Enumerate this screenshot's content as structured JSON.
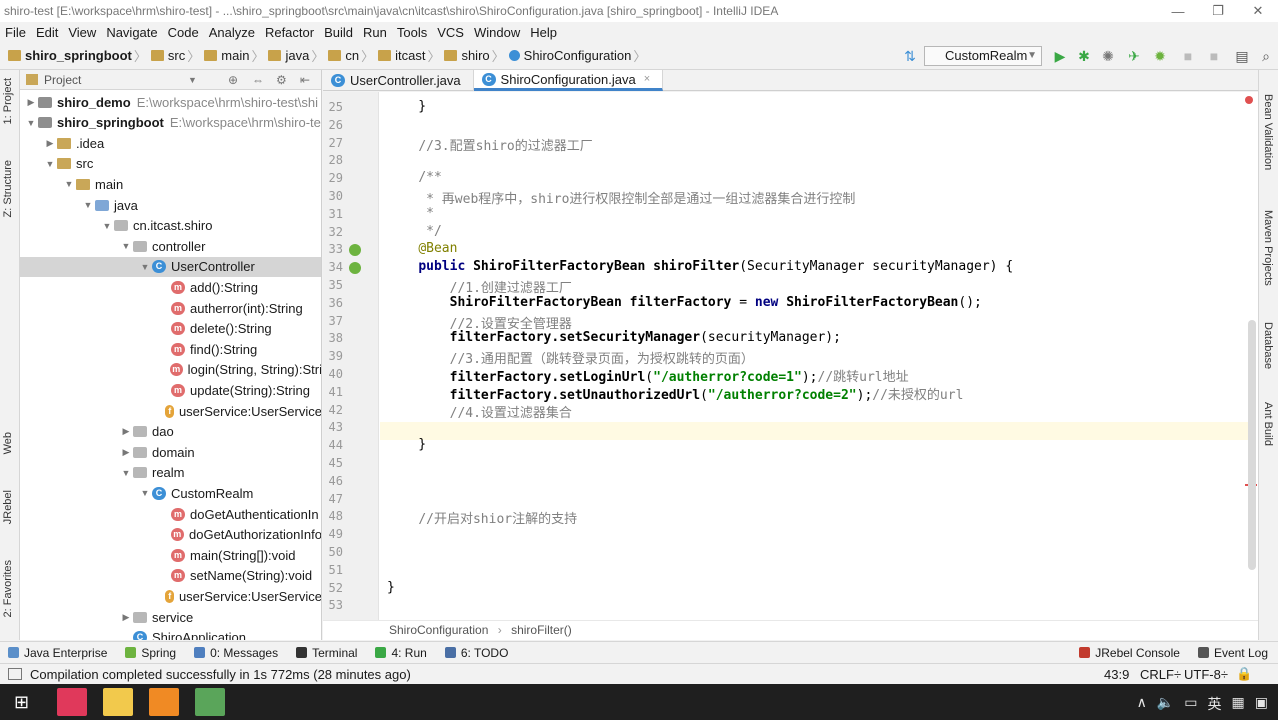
{
  "window": {
    "title": "shiro-test [E:\\workspace\\hrm\\shiro-test] - ...\\shiro_springboot\\src\\main\\java\\cn\\itcast\\shiro\\ShiroConfiguration.java [shiro_springboot] - IntelliJ IDEA",
    "minimize": "—",
    "maximize": "❐",
    "close": "✕"
  },
  "menu": [
    "File",
    "Edit",
    "View",
    "Navigate",
    "Code",
    "Analyze",
    "Refactor",
    "Build",
    "Run",
    "Tools",
    "VCS",
    "Window",
    "Help"
  ],
  "breadcrumb": [
    "shiro_springboot",
    "src",
    "main",
    "java",
    "cn",
    "itcast",
    "shiro",
    "ShiroConfiguration"
  ],
  "run_config": "CustomRealm",
  "left_strip": {
    "project": "1: Project",
    "structure": "Z: Structure",
    "web": "Web",
    "jrebel": "JRebel",
    "favorites": "2: Favorites"
  },
  "right_strip": {
    "bean": "Bean Validation",
    "maven": "Maven Projects",
    "db": "Database",
    "ant": "Ant Build"
  },
  "project_panel": {
    "header": "Project",
    "rows": [
      {
        "label": "shiro_demo",
        "path": "E:\\workspace\\hrm\\shiro-test\\shi",
        "icon": "proj",
        "arrow": "▶",
        "bold": true
      },
      {
        "label": "shiro_springboot",
        "path": "E:\\workspace\\hrm\\shiro-te",
        "icon": "proj",
        "arrow": "▼",
        "bold": true
      },
      {
        "label": ".idea",
        "path": "",
        "icon": "folder",
        "arrow": "▶",
        "bold": false
      },
      {
        "label": "src",
        "path": "",
        "icon": "folder",
        "arrow": "▼",
        "bold": false
      },
      {
        "label": "main",
        "path": "",
        "icon": "folder",
        "arrow": "▼",
        "bold": false
      },
      {
        "label": "java",
        "path": "",
        "icon": "src",
        "arrow": "▼",
        "bold": false
      },
      {
        "label": "cn.itcast.shiro",
        "path": "",
        "icon": "pkg",
        "arrow": "▼",
        "bold": false
      },
      {
        "label": "controller",
        "path": "",
        "icon": "pkg",
        "arrow": "▼",
        "bold": false
      },
      {
        "label": "UserController",
        "path": "",
        "icon": "cls",
        "arrow": "▼",
        "bold": false
      },
      {
        "label": "add():String",
        "path": "",
        "icon": "m",
        "arrow": "",
        "bold": false
      },
      {
        "label": "autherror(int):String",
        "path": "",
        "icon": "m",
        "arrow": "",
        "bold": false
      },
      {
        "label": "delete():String",
        "path": "",
        "icon": "m",
        "arrow": "",
        "bold": false
      },
      {
        "label": "find():String",
        "path": "",
        "icon": "m",
        "arrow": "",
        "bold": false
      },
      {
        "label": "login(String, String):Stri",
        "path": "",
        "icon": "m",
        "arrow": "",
        "bold": false
      },
      {
        "label": "update(String):String",
        "path": "",
        "icon": "m",
        "arrow": "",
        "bold": false
      },
      {
        "label": "userService:UserService",
        "path": "",
        "icon": "f",
        "arrow": "",
        "bold": false
      },
      {
        "label": "dao",
        "path": "",
        "icon": "pkg",
        "arrow": "▶",
        "bold": false
      },
      {
        "label": "domain",
        "path": "",
        "icon": "pkg",
        "arrow": "▶",
        "bold": false
      },
      {
        "label": "realm",
        "path": "",
        "icon": "pkg",
        "arrow": "▼",
        "bold": false
      },
      {
        "label": "CustomRealm",
        "path": "",
        "icon": "cls",
        "arrow": "▼",
        "bold": false
      },
      {
        "label": "doGetAuthenticationIn",
        "path": "",
        "icon": "m",
        "arrow": "",
        "bold": false
      },
      {
        "label": "doGetAuthorizationInfo",
        "path": "",
        "icon": "m",
        "arrow": "",
        "bold": false
      },
      {
        "label": "main(String[]):void",
        "path": "",
        "icon": "m",
        "arrow": "",
        "bold": false
      },
      {
        "label": "setName(String):void",
        "path": "",
        "icon": "m",
        "arrow": "",
        "bold": false
      },
      {
        "label": "userService:UserService",
        "path": "",
        "icon": "f",
        "arrow": "",
        "bold": false
      },
      {
        "label": "service",
        "path": "",
        "icon": "pkg",
        "arrow": "▶",
        "bold": false
      },
      {
        "label": "ShiroApplication",
        "path": "",
        "icon": "cls",
        "arrow": "",
        "bold": false
      }
    ]
  },
  "tabs": [
    {
      "label": "UserController.java",
      "active": false
    },
    {
      "label": "ShiroConfiguration.java",
      "active": true
    }
  ],
  "editor": {
    "lines": [
      {
        "n": "25",
        "html": "    }"
      },
      {
        "n": "26",
        "html": ""
      },
      {
        "n": "27",
        "html": "    <span class='cmt'>//3.配置shiro的过滤器工厂</span>"
      },
      {
        "n": "28",
        "html": ""
      },
      {
        "n": "29",
        "html": "    <span class='cmt'>/**</span>"
      },
      {
        "n": "30",
        "html": "    <span class='cmt'> * 再web程序中，shiro进行权限控制全部是通过一组过滤器集合进行控制</span>"
      },
      {
        "n": "31",
        "html": "    <span class='cmt'> *</span>"
      },
      {
        "n": "32",
        "html": "    <span class='cmt'> */</span>"
      },
      {
        "n": "33",
        "html": "    <span class='ann'>@Bean</span>"
      },
      {
        "n": "34",
        "html": "    <span class='kw'>public</span> <span class='meth'>ShiroFilterFactoryBean</span> <span class='meth'>shiroFilter</span>(SecurityManager securityManager) {"
      },
      {
        "n": "35",
        "html": "        <span class='cmt'>//1.创建过滤器工厂</span>"
      },
      {
        "n": "36",
        "html": "        <span class='meth'>ShiroFilterFactoryBean filterFactory</span> = <span class='kw'>new</span> <span class='meth'>ShiroFilterFactoryBean</span>();"
      },
      {
        "n": "37",
        "html": "        <span class='cmt'>//2.设置安全管理器</span>"
      },
      {
        "n": "38",
        "html": "        <span class='meth'>filterFactory.setSecurityManager</span>(securityManager);"
      },
      {
        "n": "39",
        "html": "        <span class='cmt'>//3.通用配置（跳转登录页面，为授权跳转的页面）</span>"
      },
      {
        "n": "40",
        "html": "        <span class='meth'>filterFactory.setLoginUrl</span>(<span class='str'>\"/autherror?code=1\"</span>);<span class='cmt'>//跳转url地址</span>"
      },
      {
        "n": "41",
        "html": "        <span class='meth'>filterFactory.setUnauthorizedUrl</span>(<span class='str'>\"/autherror?code=2\"</span>);<span class='cmt'>//未授权的url</span>"
      },
      {
        "n": "42",
        "html": "        <span class='cmt'>//4.设置过滤器集合</span>"
      },
      {
        "n": "43",
        "html": ""
      },
      {
        "n": "44",
        "html": "    }"
      },
      {
        "n": "45",
        "html": ""
      },
      {
        "n": "46",
        "html": ""
      },
      {
        "n": "47",
        "html": ""
      },
      {
        "n": "48",
        "html": "    <span class='cmt'>//开启对shior注解的支持</span>"
      },
      {
        "n": "49",
        "html": ""
      },
      {
        "n": "50",
        "html": ""
      },
      {
        "n": "51",
        "html": ""
      },
      {
        "n": "52",
        "html": "}"
      },
      {
        "n": "53",
        "html": ""
      }
    ],
    "line_top_partial": "        ;"
  },
  "editor_breadcrumb": {
    "file": "ShiroConfiguration",
    "sep": "›",
    "method": "shiroFilter()"
  },
  "tool_windows": [
    {
      "label": "Java Enterprise",
      "color": "#5b8fc9"
    },
    {
      "label": "Spring",
      "color": "#6db33f"
    },
    {
      "label": "0: Messages",
      "color": "#4f7fbf"
    },
    {
      "label": "Terminal",
      "color": "#333333"
    },
    {
      "label": "4: Run",
      "color": "#3aa845"
    },
    {
      "label": "6: TODO",
      "color": "#4a6fa5"
    }
  ],
  "tool_windows_right": [
    {
      "label": "JRebel Console",
      "color": "#c23b2e"
    },
    {
      "label": "Event Log",
      "color": "#555555"
    }
  ],
  "status": {
    "message": "Compilation completed successfully in 1s 772ms (28 minutes ago)",
    "position": "43:9",
    "line_sep": "CRLF÷",
    "encoding": "UTF-8÷"
  },
  "taskbar": {
    "apps": [
      {
        "name": "intellij",
        "color": "#e0395b"
      },
      {
        "name": "explorer",
        "color": "#f2c94c"
      },
      {
        "name": "media",
        "color": "#f08a24"
      },
      {
        "name": "notepad",
        "color": "#5aa55a"
      }
    ],
    "tray": [
      "∧",
      "🔈",
      "▭",
      "英",
      "▦",
      "▣"
    ]
  }
}
